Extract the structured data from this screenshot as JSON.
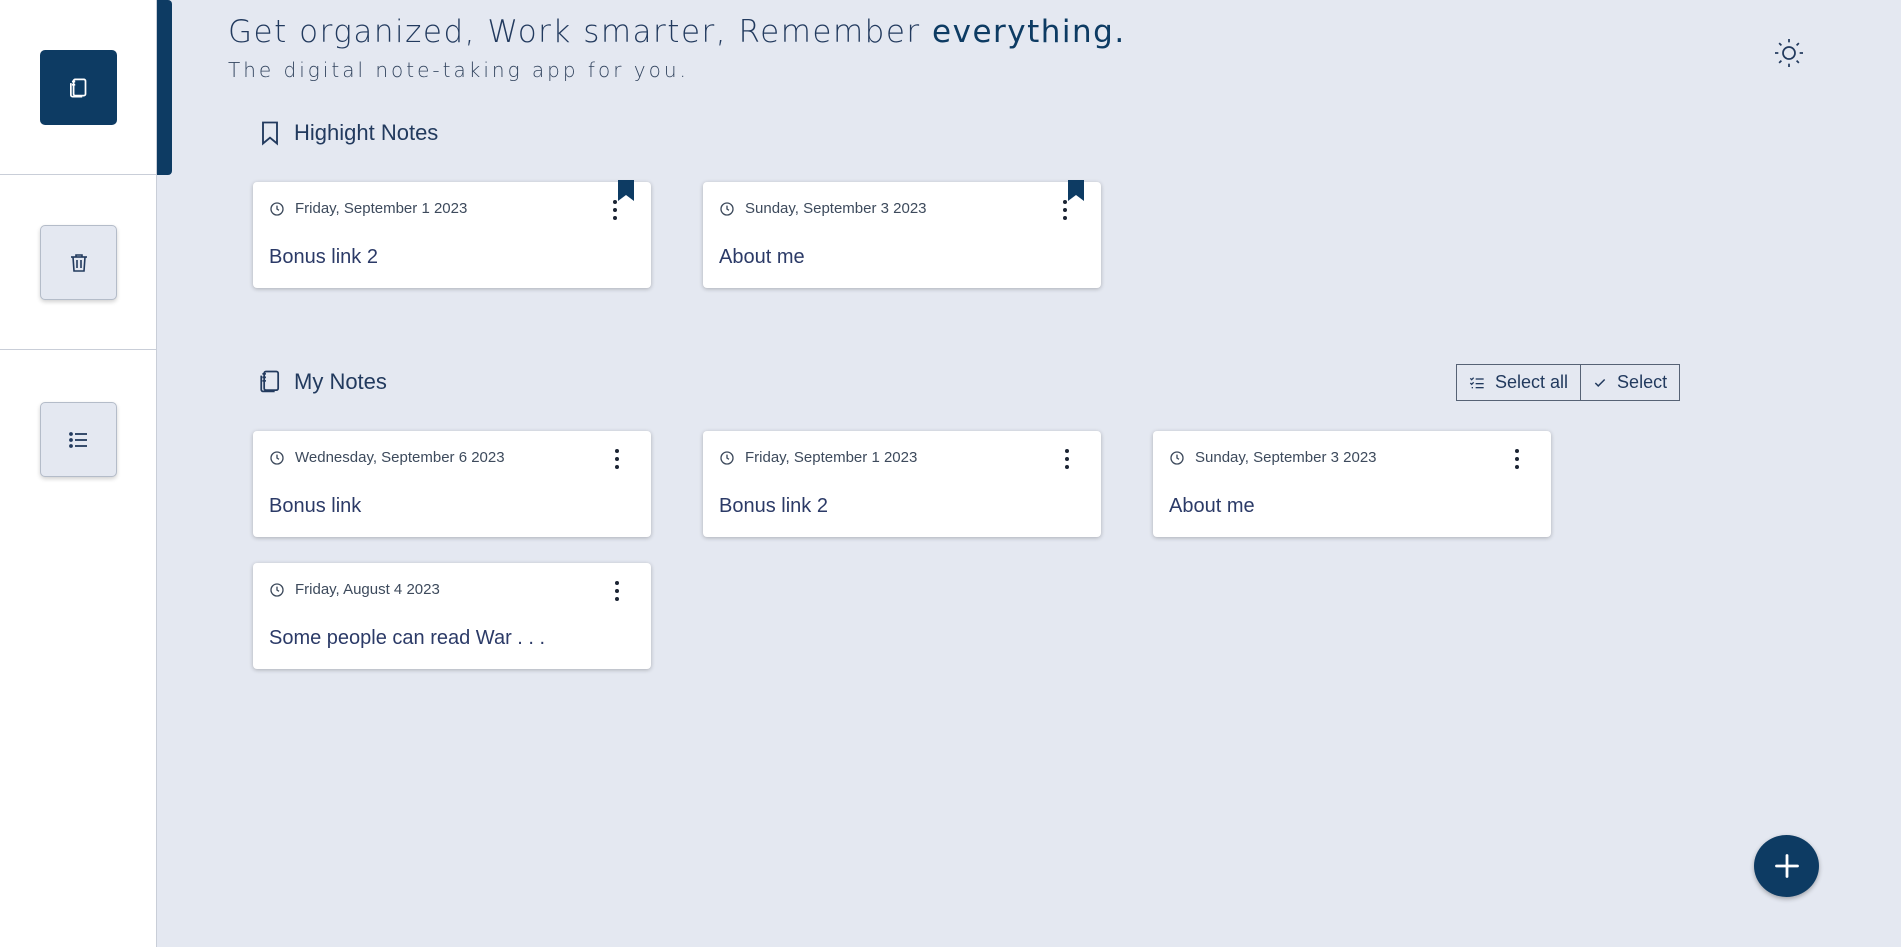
{
  "header": {
    "title_main": "Get organized, Work smarter, Remember ",
    "title_emphasis": "everything.",
    "subtitle": "The digital note-taking app for you."
  },
  "sidebar": {
    "items": [
      {
        "name": "notes",
        "icon": "notebook-icon",
        "active": true
      },
      {
        "name": "trash",
        "icon": "trash-icon",
        "active": false
      },
      {
        "name": "list",
        "icon": "list-icon",
        "active": false
      }
    ]
  },
  "highlight_section": {
    "label": "Highight Notes",
    "icon": "bookmark-outline-icon",
    "notes": [
      {
        "date": "Friday, September 1 2023",
        "title": "Bonus link 2",
        "bookmarked": true
      },
      {
        "date": "Sunday, September 3 2023",
        "title": "About me",
        "bookmarked": true
      }
    ]
  },
  "my_notes_section": {
    "label": "My Notes",
    "icon": "notebook-icon",
    "select_all_label": "Select all",
    "select_label": "Select",
    "notes": [
      {
        "date": "Wednesday, September 6 2023",
        "title": "Bonus link"
      },
      {
        "date": "Friday, September 1 2023",
        "title": "Bonus link 2"
      },
      {
        "date": "Sunday, September 3 2023",
        "title": "About me"
      },
      {
        "date": "Friday, August 4 2023",
        "title": "Some people can read War . . ."
      }
    ]
  },
  "colors": {
    "accent": "#0d3b63",
    "background": "#e4e8f1",
    "text": "#223a5e"
  }
}
